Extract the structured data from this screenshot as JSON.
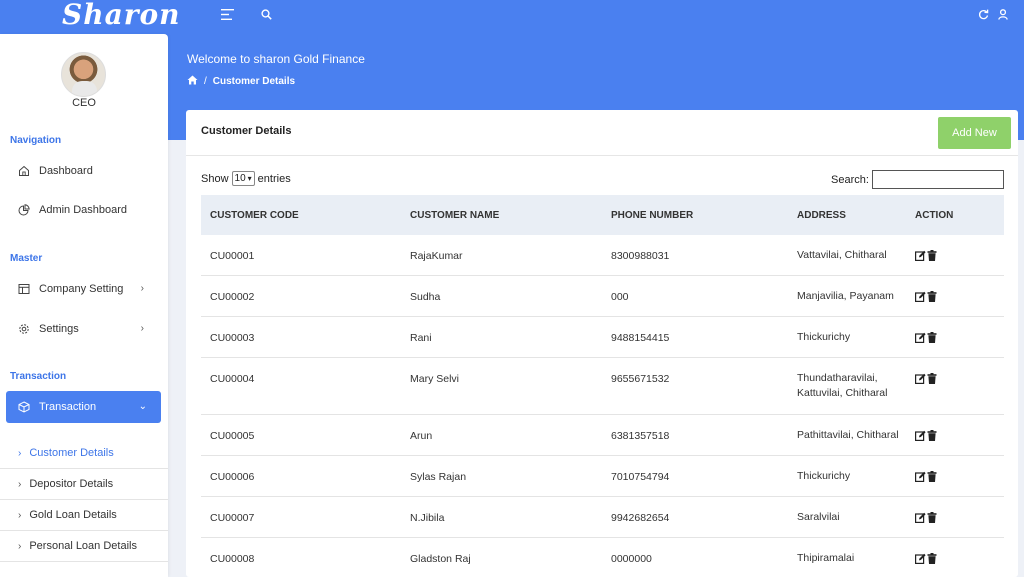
{
  "app": {
    "logo": "Sharon",
    "welcome": "Welcome to sharon Gold Finance"
  },
  "breadcrumb": {
    "current": "Customer Details"
  },
  "user": {
    "role": "CEO"
  },
  "sidebar": {
    "sections": [
      "Navigation",
      "Master",
      "Transaction"
    ],
    "items": [
      {
        "label": "Dashboard",
        "icon": "home-icon"
      },
      {
        "label": "Admin Dashboard",
        "icon": "pie-chart-icon"
      },
      {
        "label": "Company Setting",
        "icon": "layout-icon"
      },
      {
        "label": "Settings",
        "icon": "gear-icon"
      },
      {
        "label": "Transaction",
        "icon": "box-icon"
      }
    ],
    "sub_items": [
      "Customer Details",
      "Depositor Details",
      "Gold Loan Details",
      "Personal Loan Details"
    ]
  },
  "card": {
    "title": "Customer Details",
    "add_button": "Add New",
    "show_label": "Show",
    "entries_label": "entries",
    "entries_value": "10",
    "search_label": "Search:"
  },
  "table": {
    "headers": [
      "CUSTOMER CODE",
      "CUSTOMER NAME",
      "PHONE NUMBER",
      "ADDRESS",
      "ACTION"
    ],
    "rows": [
      {
        "code": "CU00001",
        "name": "RajaKumar",
        "phone": "8300988031",
        "address": "Vattavilai, Chitharal"
      },
      {
        "code": "CU00002",
        "name": "Sudha",
        "phone": "000",
        "address": "Manjavilia, Payanam"
      },
      {
        "code": "CU00003",
        "name": "Rani",
        "phone": "9488154415",
        "address": "Thickurichy"
      },
      {
        "code": "CU00004",
        "name": "Mary Selvi",
        "phone": "9655671532",
        "address": "Thundatharavilai, Kattuvilai, Chitharal"
      },
      {
        "code": "CU00005",
        "name": "Arun",
        "phone": "6381357518",
        "address": "Pathittavilai, Chitharal"
      },
      {
        "code": "CU00006",
        "name": "Sylas Rajan",
        "phone": "7010754794",
        "address": "Thickurichy"
      },
      {
        "code": "CU00007",
        "name": "N.Jibila",
        "phone": "9942682654",
        "address": "Saralvilai"
      },
      {
        "code": "CU00008",
        "name": "Gladston Raj",
        "phone": "0000000",
        "address": "Thipiramalai"
      }
    ]
  },
  "colors": {
    "primary": "#4a80f0",
    "add_button": "#8fd16a",
    "section_label": "#3d75e8"
  }
}
